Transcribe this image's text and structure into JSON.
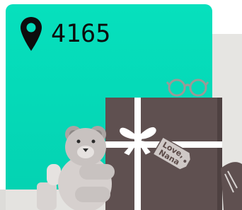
{
  "location": {
    "icon": "map-pin-icon",
    "count": "4165"
  },
  "gift_tag": {
    "line1": "Love,",
    "line2": "Nana"
  },
  "colors": {
    "card": "#05dcbb",
    "gift_box": "#5f5050",
    "ribbon": "#ffffff",
    "bear": "#c8c2c0"
  }
}
